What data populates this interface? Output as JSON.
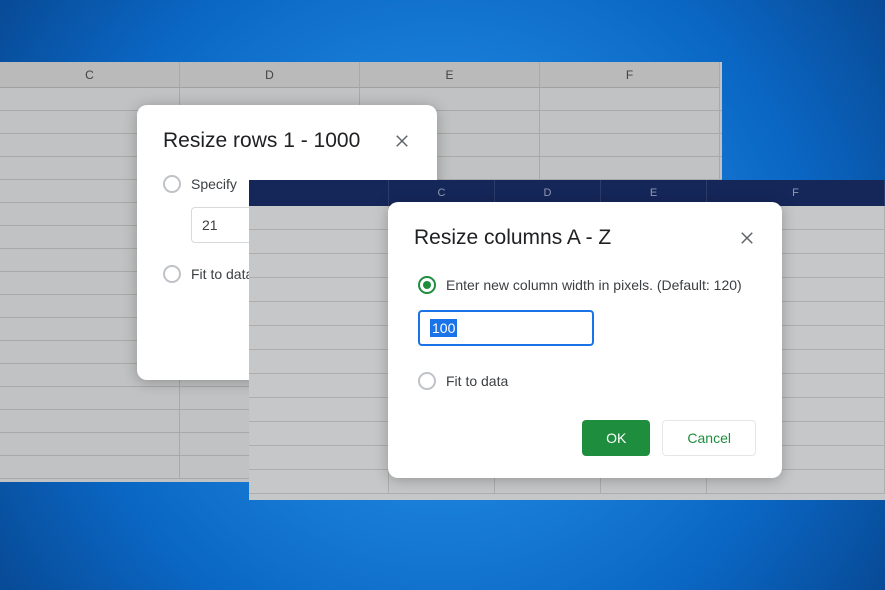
{
  "back_sheet": {
    "columns": [
      "C",
      "D",
      "E",
      "F"
    ]
  },
  "front_sheet": {
    "columns": [
      "C",
      "D",
      "E",
      "F"
    ]
  },
  "rows_dialog": {
    "title": "Resize rows 1 - 1000",
    "specify_label": "Specify",
    "value": "21",
    "fit_label": "Fit to data"
  },
  "cols_dialog": {
    "title": "Resize columns A - Z",
    "enter_label": "Enter new column width in pixels. (Default: 120)",
    "value": "100",
    "fit_label": "Fit to data",
    "ok_label": "OK",
    "cancel_label": "Cancel"
  },
  "colors": {
    "accent_green": "#1e8e3e",
    "focus_blue": "#1a73e8"
  }
}
